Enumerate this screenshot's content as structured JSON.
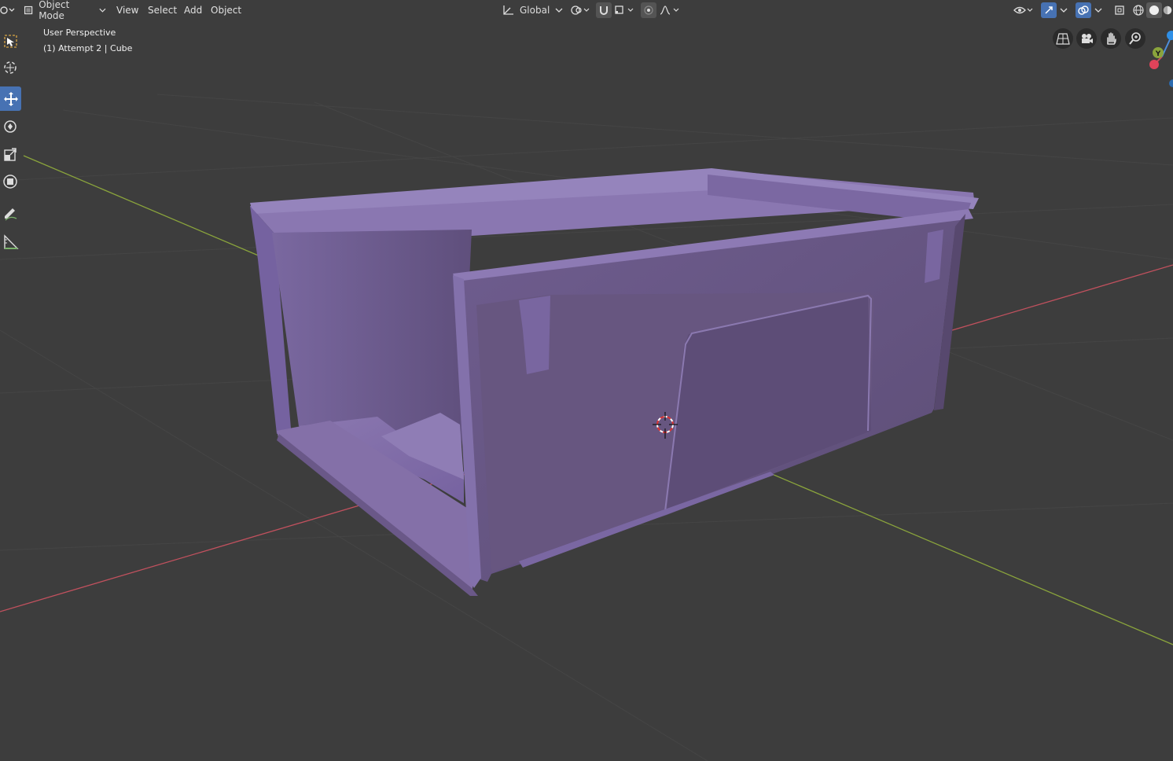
{
  "header": {
    "mode_label": "Object Mode",
    "menus": [
      "View",
      "Select",
      "Add",
      "Object"
    ],
    "orientation_label": "Global"
  },
  "viewport": {
    "perspective_label": "User Perspective",
    "object_info": "(1) Attempt 2 | Cube"
  },
  "gizmo": {
    "y_axis_label": "Y"
  },
  "colors": {
    "background": "#3d3d3d",
    "mesh_purple": "#7d6aa0",
    "x_axis": "#c1515e",
    "y_axis": "#8aa43c",
    "accent": "#4772b3"
  },
  "toolbar": {
    "tools": [
      "select-box",
      "cursor",
      "move",
      "rotate",
      "scale",
      "transform",
      "annotate",
      "measure"
    ],
    "active_tool": "move"
  }
}
